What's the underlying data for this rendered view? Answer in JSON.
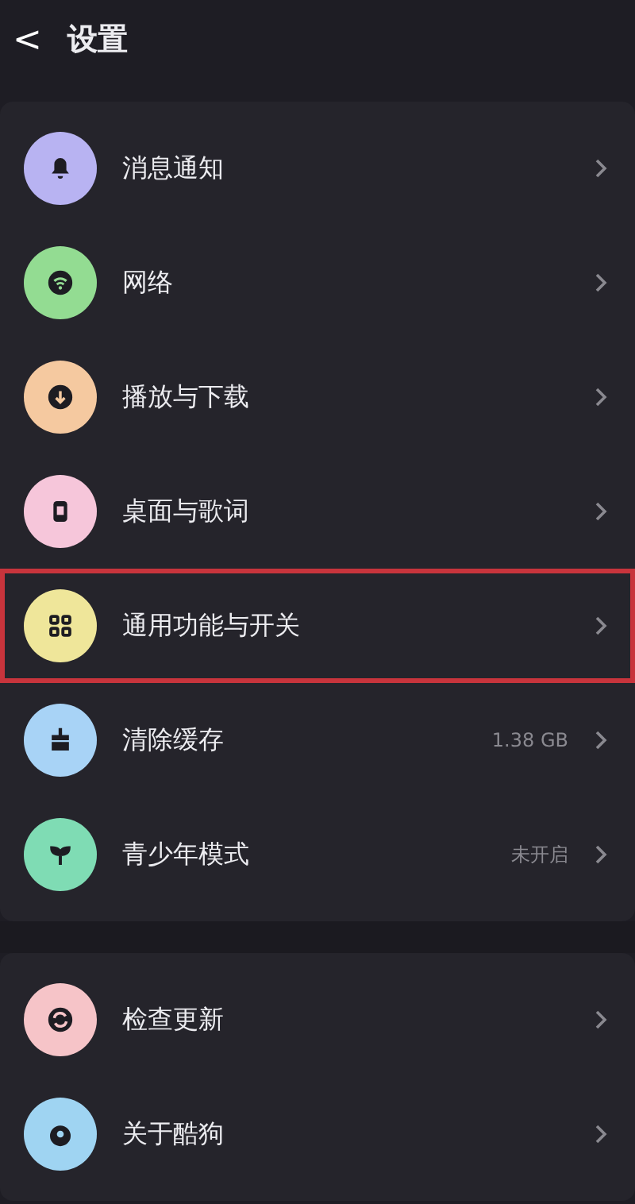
{
  "header": {
    "back": "<",
    "title": "设置"
  },
  "groups": [
    {
      "items": [
        {
          "label": "消息通知",
          "color": "#b8b3f2",
          "highlighted": false
        },
        {
          "label": "网络",
          "color": "#93dc92",
          "highlighted": false
        },
        {
          "label": "播放与下载",
          "color": "#f5c9a0",
          "highlighted": false
        },
        {
          "label": "桌面与歌词",
          "color": "#f6c6da",
          "highlighted": false
        },
        {
          "label": "通用功能与开关",
          "color": "#efe69a",
          "highlighted": true
        },
        {
          "label": "清除缓存",
          "value": "1.38 GB",
          "color": "#a8d3f6",
          "highlighted": false
        },
        {
          "label": "青少年模式",
          "value": "未开启",
          "color": "#7fdcb4",
          "highlighted": false
        }
      ]
    },
    {
      "items": [
        {
          "label": "检查更新",
          "color": "#f6c4c8",
          "highlighted": false
        },
        {
          "label": "关于酷狗",
          "color": "#9fd4f2",
          "highlighted": false
        }
      ]
    }
  ]
}
